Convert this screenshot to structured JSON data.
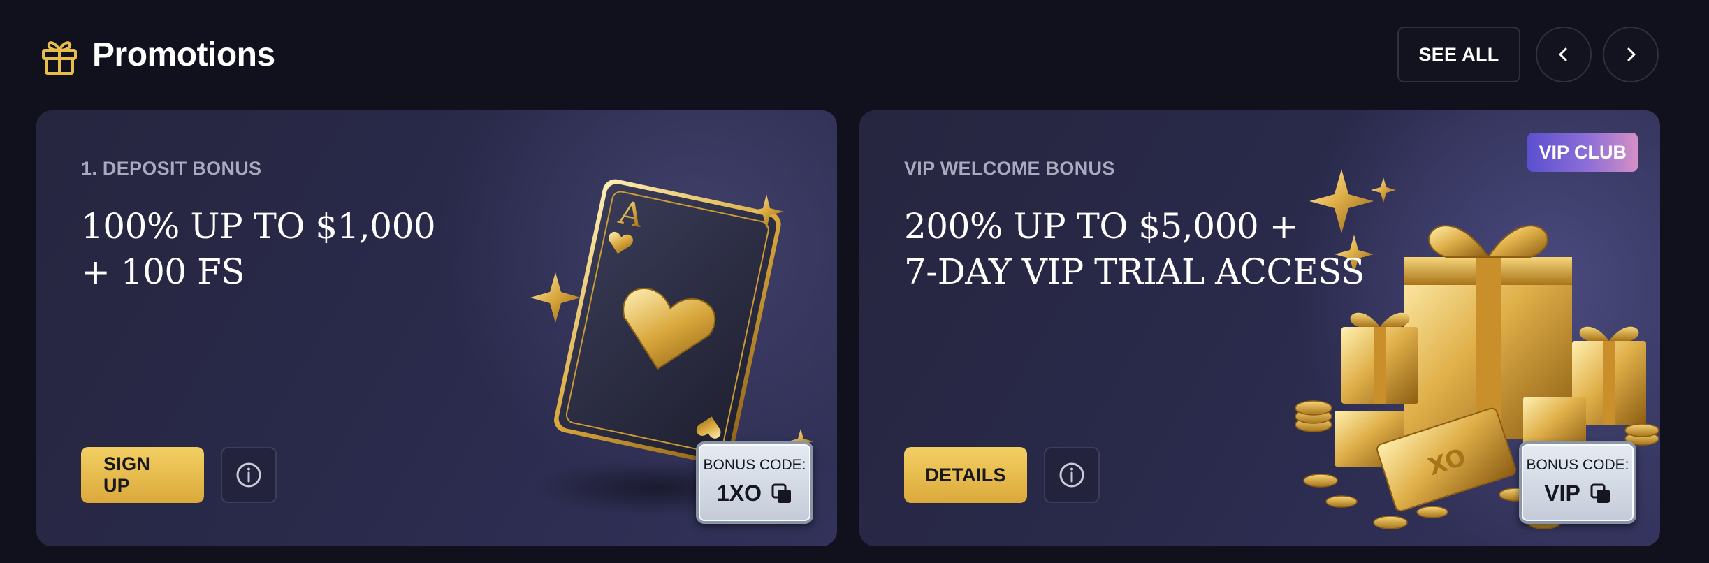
{
  "header": {
    "icon": "gift-icon",
    "title": "Promotions",
    "see_all_label": "SEE ALL",
    "prev_icon": "chevron-left-icon",
    "next_icon": "chevron-right-icon"
  },
  "colors": {
    "background": "#10111c",
    "accent_gold": "#e8bd4c",
    "card": "#2a2a48"
  },
  "promotions": [
    {
      "eyebrow": "1. DEPOSIT BONUS",
      "headline": "100% UP TO $1,000\n+ 100 FS",
      "cta_label": "SIGN UP",
      "info_icon": "info-icon",
      "bonus_code_label": "BONUS CODE:",
      "bonus_code_value": "1XO",
      "copy_icon": "copy-icon",
      "art": "ace-of-hearts-card"
    },
    {
      "eyebrow": "VIP WELCOME BONUS",
      "headline": "200% UP TO $5,000 +\n7-DAY VIP TRIAL ACCESS",
      "cta_label": "DETAILS",
      "info_icon": "info-icon",
      "bonus_code_label": "BONUS CODE:",
      "bonus_code_value": "VIP",
      "copy_icon": "copy-icon",
      "badge": "VIP CLUB",
      "art": "gold-gift-boxes",
      "art_emblem": "XO"
    }
  ]
}
